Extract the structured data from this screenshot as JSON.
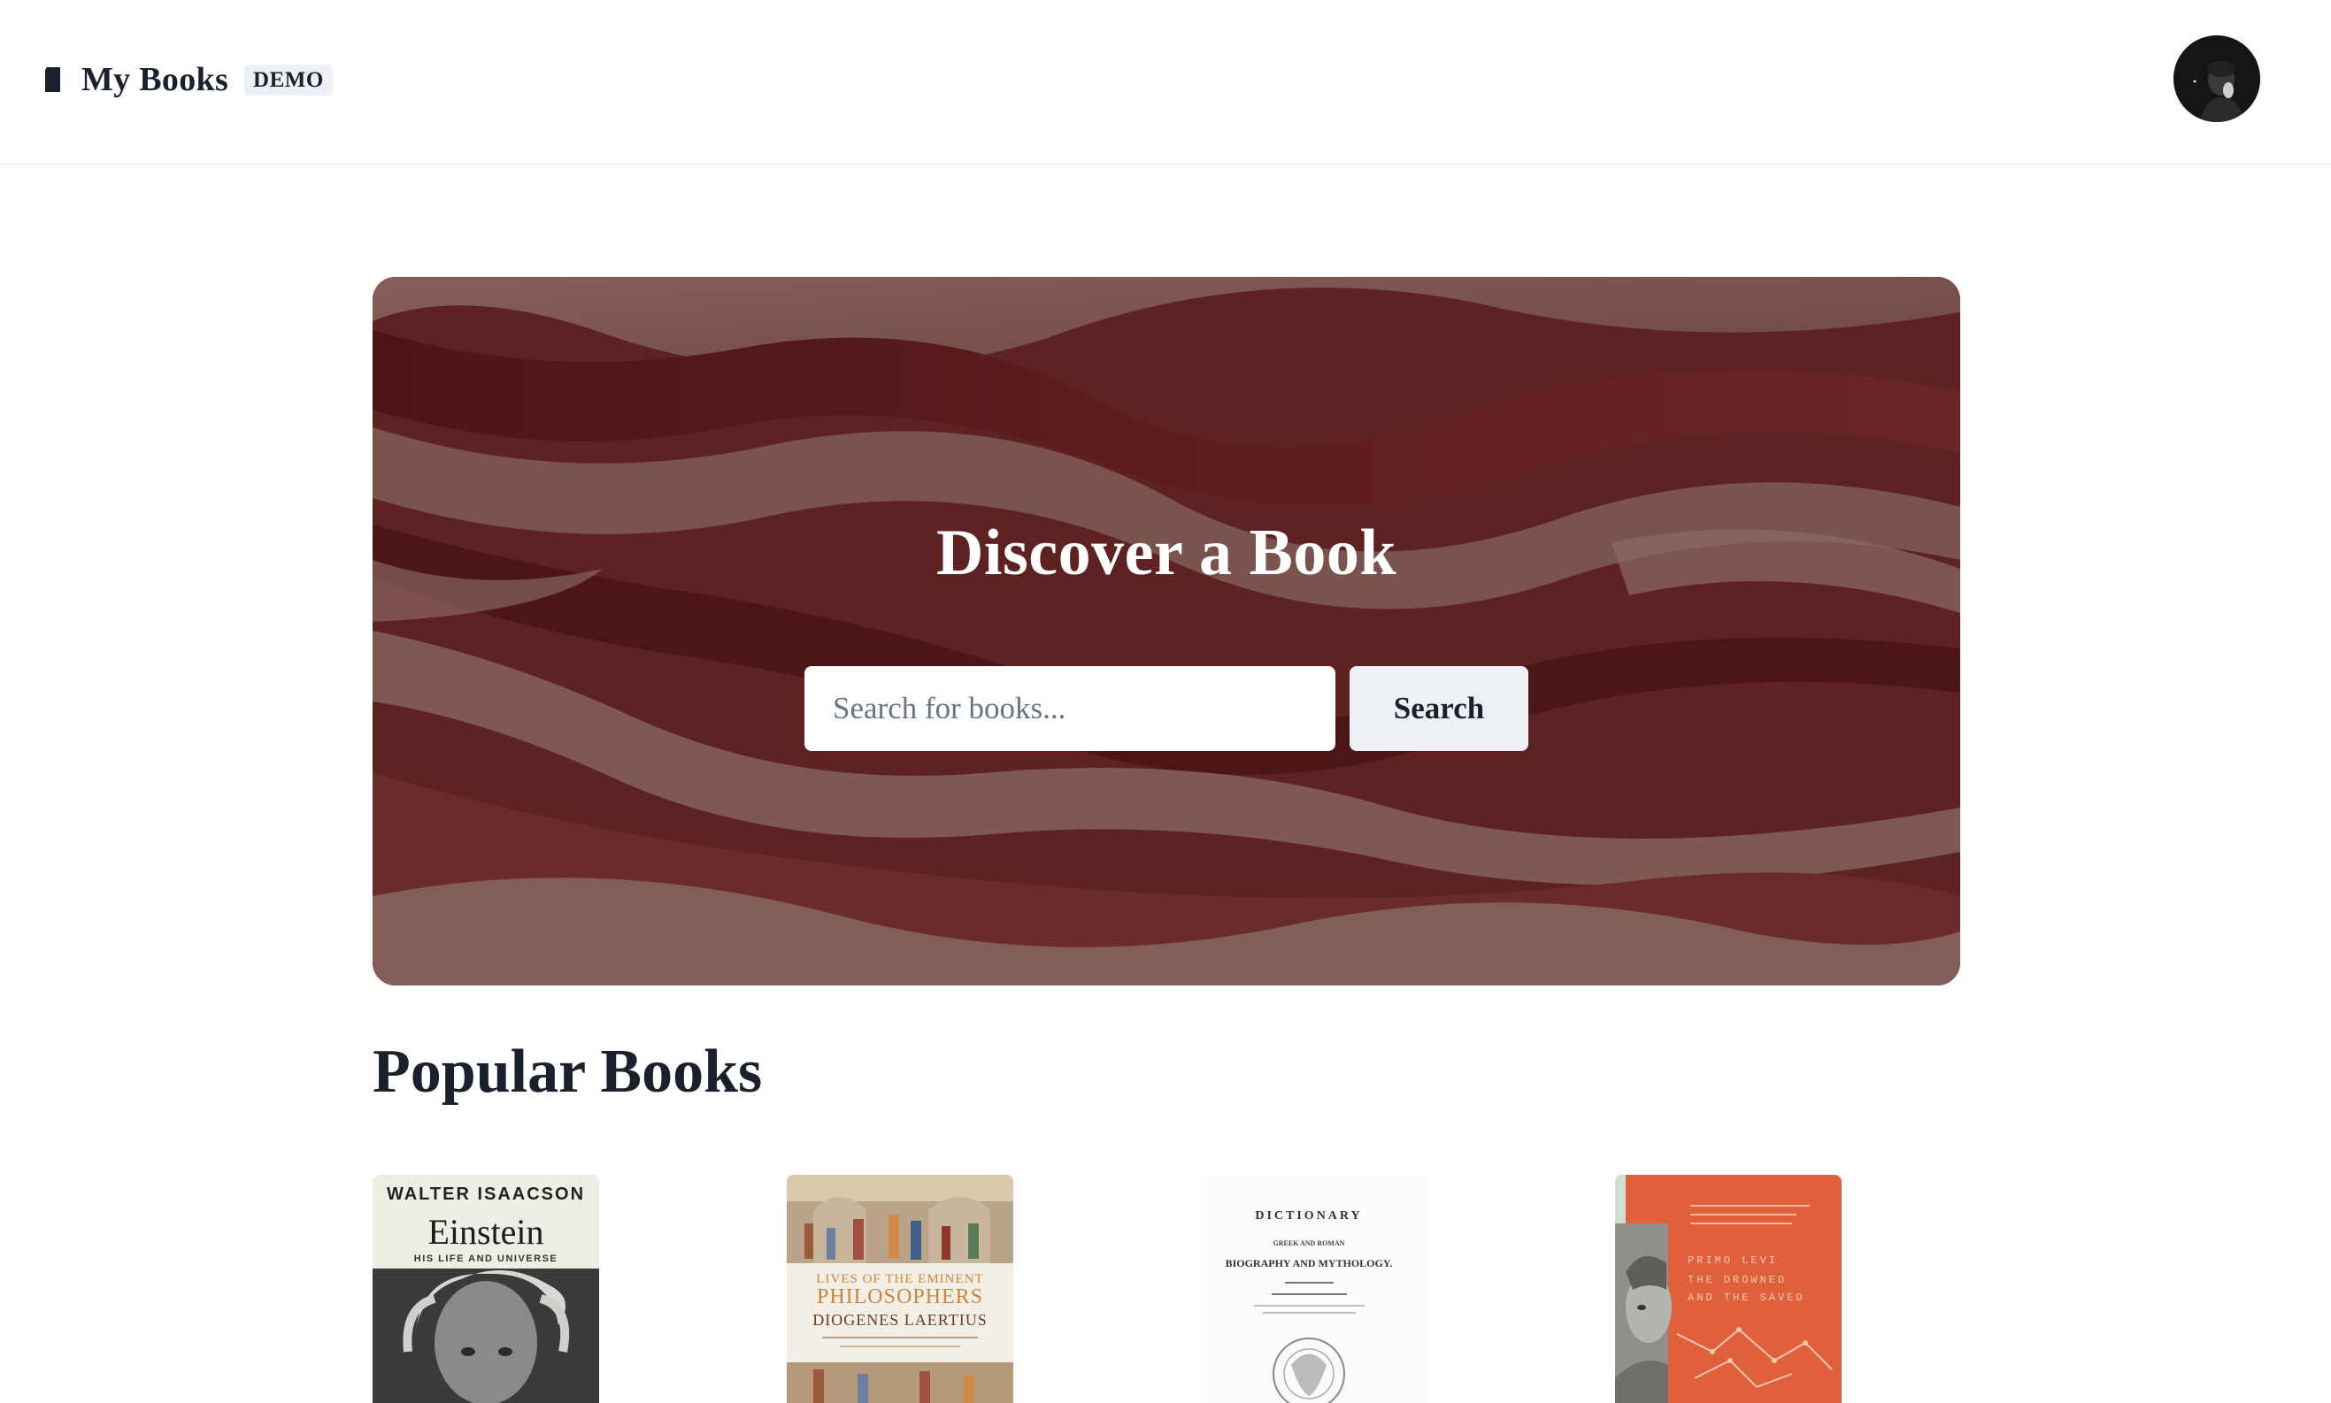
{
  "header": {
    "brand_icon": "book-icon",
    "title": "My Books",
    "badge": "DEMO",
    "avatar": "user-avatar"
  },
  "hero": {
    "title": "Discover a Book",
    "search_placeholder": "Search for books...",
    "search_button": "Search",
    "colors": {
      "base": "#5a1f20",
      "light": "#7e5a55",
      "dark": "#4a1414"
    }
  },
  "popular": {
    "heading": "Popular Books",
    "books": [
      {
        "author": "WALTER ISAACSON",
        "title": "Einstein",
        "subtitle": "HIS LIFE AND UNIVERSE"
      },
      {
        "title_line1": "LIVES OF THE EMINENT",
        "title_line2": "PHILOSOPHERS",
        "author": "DIOGENES LAERTIUS"
      },
      {
        "line1": "DICTIONARY",
        "line2": "GREEK AND ROMAN",
        "line3": "BIOGRAPHY AND MYTHOLOGY."
      },
      {
        "author": "PRIMO LEVI",
        "title_line1": "THE DROWNED",
        "title_line2": "AND THE SAVED"
      }
    ]
  }
}
